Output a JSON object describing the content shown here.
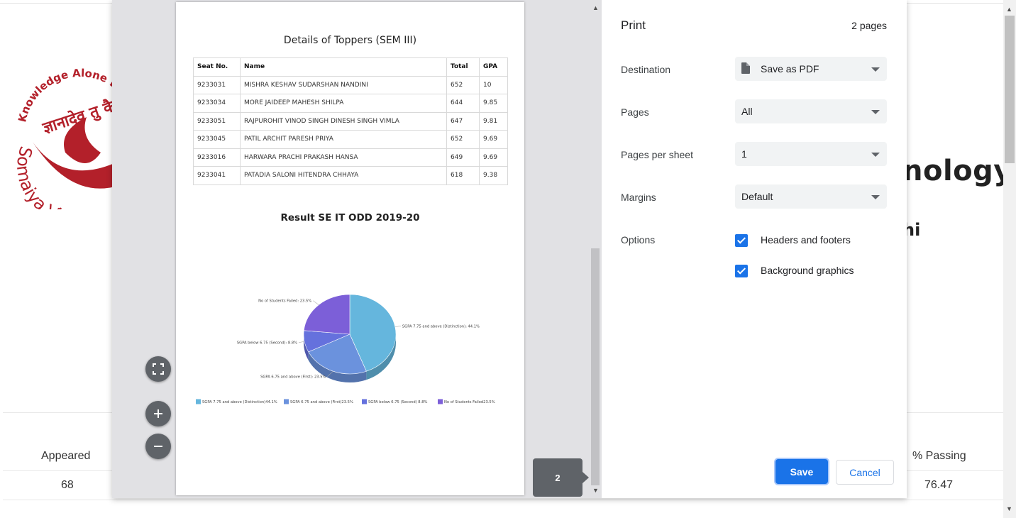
{
  "background": {
    "logo_text_top": "Knowledge Alone Li",
    "logo_text_hindi": "ज्ञानादेव तु कैव",
    "logo_text_bottom": "Somaiya Vidy",
    "title_fragment": "nology",
    "subtitle_fragment": "hi",
    "table_headers": [
      "Appeared",
      "% Passing"
    ],
    "table_values": [
      "68",
      "76.47"
    ]
  },
  "preview": {
    "toppers_title": "Details of Toppers (SEM III)",
    "columns": [
      "Seat No.",
      "Name",
      "Total",
      "GPA"
    ],
    "rows": [
      [
        "9233031",
        "MISHRA KESHAV SUDARSHAN NANDINI",
        "652",
        "10"
      ],
      [
        "9233034",
        "MORE JAIDEEP MAHESH SHILPA",
        "644",
        "9.85"
      ],
      [
        "9233051",
        "RAJPUROHIT VINOD SINGH DINESH SINGH VIMLA",
        "647",
        "9.81"
      ],
      [
        "9233045",
        "PATIL ARCHIT PARESH PRIYA",
        "652",
        "9.69"
      ],
      [
        "9233016",
        "HARWARA PRACHI PRAKASH HANSA",
        "649",
        "9.69"
      ],
      [
        "9233041",
        "PATADIA SALONI HITENDRA CHHAYA",
        "618",
        "9.38"
      ]
    ],
    "chart_title": "Result SE IT ODD 2019-20",
    "page_indicator": "2",
    "fit_icon": "fit-to-page-icon",
    "zoom_in_icon": "plus-icon",
    "zoom_out_icon": "minus-icon"
  },
  "chart_data": {
    "type": "pie",
    "title": "Result SE IT ODD 2019-20",
    "labels": [
      "SGPA 7.75 and above (Distinction)",
      "SGPA 6.75 and above (First)",
      "SGPA below 6.75 (Second)",
      "No of Students Failed"
    ],
    "values": [
      44.1,
      23.5,
      8.8,
      23.5
    ],
    "slice_labels": [
      "SGPA 7.75 and above (Distinction): 44.1%",
      "SGPA 6.75 and above (First): 23.5%",
      "SGPA below 6.75 (Second): 8.8%",
      "No of Students Failed: 23.5%"
    ],
    "legend_labels": [
      "SGPA 7.75 and above (Distinction)44.1%",
      "SGPA 6.75 and above (First)23.5%",
      "SGPA below 6.75 (Second) 8.8%",
      "No of Students Failed23.5%"
    ],
    "colors": [
      "#65b6dd",
      "#6b92dd",
      "#6571dd",
      "#7c5fd8"
    ],
    "legend_position": "bottom"
  },
  "settings": {
    "title": "Print",
    "page_count": "2 pages",
    "destination_label": "Destination",
    "destination_value": "Save as PDF",
    "pages_label": "Pages",
    "pages_value": "All",
    "pages_per_sheet_label": "Pages per sheet",
    "pages_per_sheet_value": "1",
    "margins_label": "Margins",
    "margins_value": "Default",
    "options_label": "Options",
    "headers_footers_label": "Headers and footers",
    "background_graphics_label": "Background graphics",
    "save_label": "Save",
    "cancel_label": "Cancel",
    "accent_color": "#1a73e8"
  }
}
